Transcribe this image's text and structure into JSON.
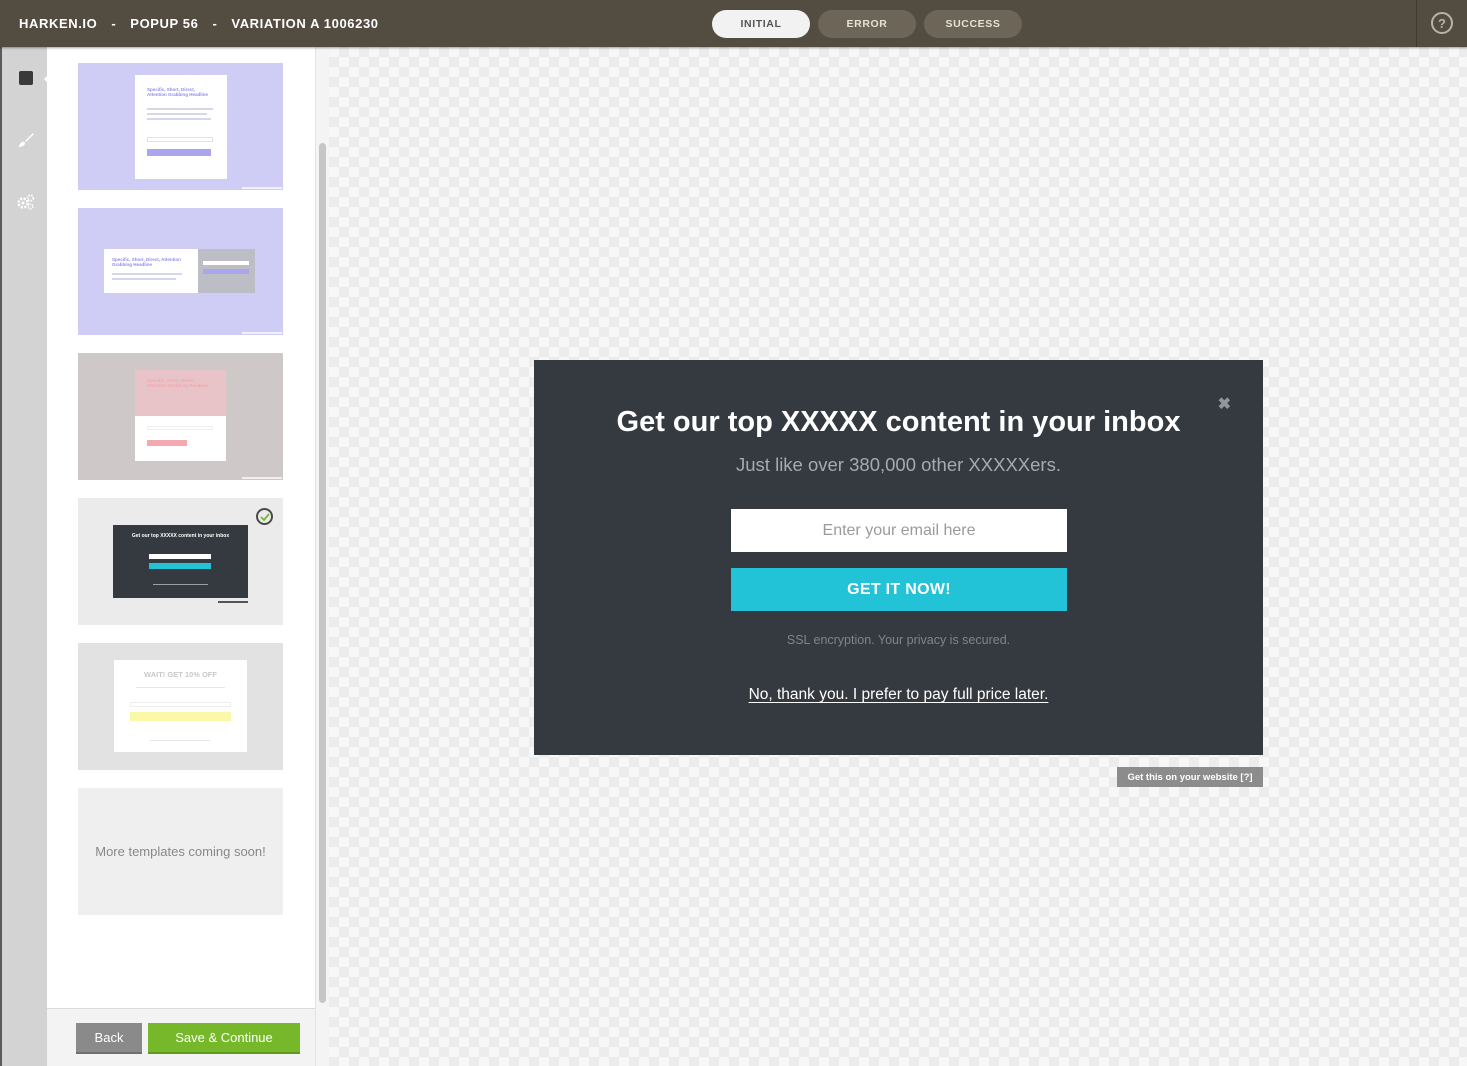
{
  "header": {
    "brand": "HARKEN.IO",
    "separator": "-",
    "popup_name": "POPUP 56",
    "variation": "VARIATION A 1006230",
    "help_label": "?",
    "states": [
      {
        "label": "INITIAL",
        "active": true
      },
      {
        "label": "ERROR",
        "active": false
      },
      {
        "label": "SUCCESS",
        "active": false
      }
    ]
  },
  "rail": {
    "icons": [
      "layout-icon",
      "brush-icon",
      "gears-icon"
    ]
  },
  "templates": {
    "items": [
      {
        "style": "lavender-vertical",
        "headline": "Specific, Short, Direct, Attention Grabbing Headline",
        "selected": false
      },
      {
        "style": "lavender-horizontal",
        "headline": "Specific, Short, Direct, Attention Grabbing Headline",
        "selected": false
      },
      {
        "style": "rose-vertical",
        "headline": "Specific, Short, Direct, Attention Grabbing Headline",
        "selected": false
      },
      {
        "style": "dark",
        "headline": "Get our top XXXXX content in your inbox",
        "selected": true
      },
      {
        "style": "light-discount",
        "headline": "WAIT! GET 10% OFF",
        "selected": false
      }
    ],
    "coming_soon": "More templates coming soon!"
  },
  "footer": {
    "back_label": "Back",
    "save_label": "Save & Continue"
  },
  "popup": {
    "close_symbol": "✖",
    "title": "Get our top XXXXX content in your inbox",
    "subtitle": "Just like over 380,000 other XXXXXers.",
    "email_placeholder": "Enter your email here",
    "cta_label": "GET IT NOW!",
    "ssl_text": "SSL encryption. Your privacy is secured.",
    "decline_text": "No, thank you. I prefer to pay full price later.",
    "colors": {
      "background": "#343a3f",
      "cta": "#22c3d6"
    }
  },
  "get_this": "Get this on your website [?]"
}
